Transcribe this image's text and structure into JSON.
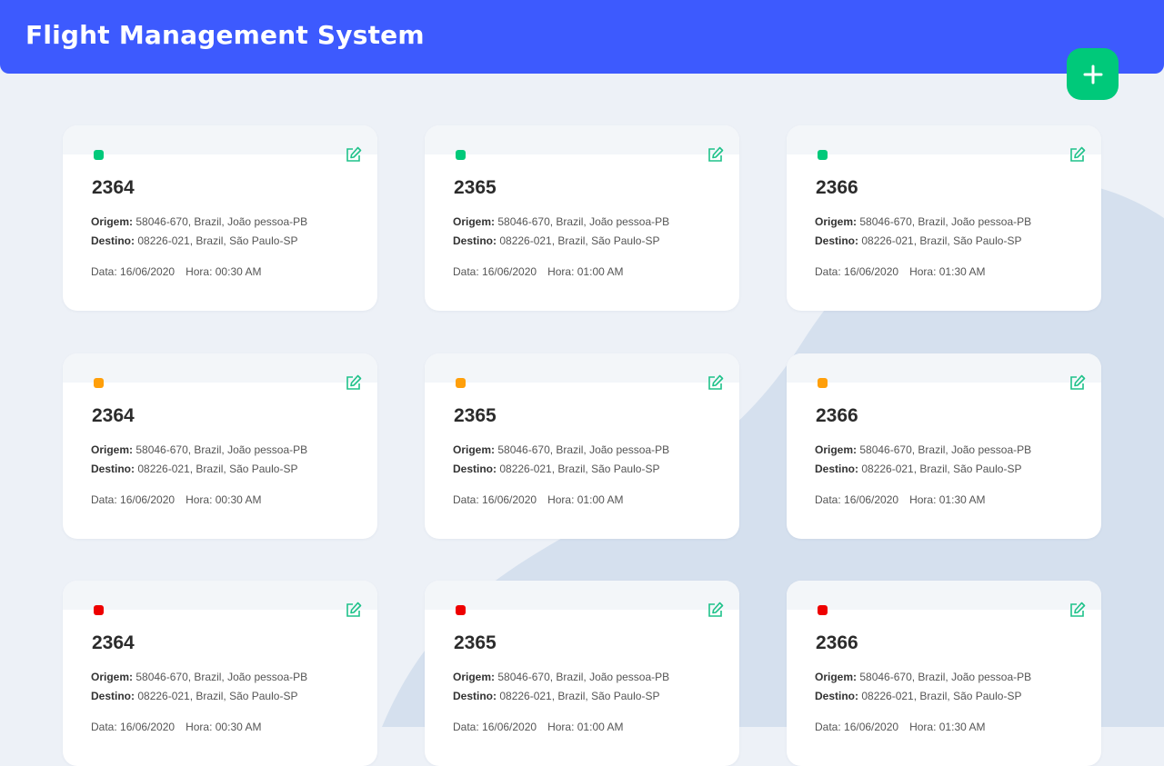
{
  "header": {
    "title": "Flight Management System"
  },
  "add_button": {
    "icon": "plus-icon"
  },
  "labels": {
    "origem": "Origem:",
    "destino": "Destino:"
  },
  "status_colors": {
    "green": "#00c97a",
    "orange": "#ff9f0a",
    "red": "#ee0000"
  },
  "edit_color": "#1fc28a",
  "flights": [
    {
      "status": "green",
      "number": "2364",
      "origem": "58046-670, Brazil, João pessoa-PB",
      "destino": "08226-021, Brazil, São Paulo-SP",
      "data": "Data: 16/06/2020",
      "hora": "Hora: 00:30 AM"
    },
    {
      "status": "green",
      "number": "2365",
      "origem": "58046-670, Brazil, João pessoa-PB",
      "destino": "08226-021, Brazil, São Paulo-SP",
      "data": "Data: 16/06/2020",
      "hora": "Hora: 01:00 AM"
    },
    {
      "status": "green",
      "number": "2366",
      "origem": "58046-670, Brazil, João pessoa-PB",
      "destino": "08226-021, Brazil, São Paulo-SP",
      "data": "Data: 16/06/2020",
      "hora": "Hora: 01:30 AM"
    },
    {
      "status": "orange",
      "number": "2364",
      "origem": "58046-670, Brazil, João pessoa-PB",
      "destino": "08226-021, Brazil, São Paulo-SP",
      "data": "Data: 16/06/2020",
      "hora": "Hora: 00:30 AM"
    },
    {
      "status": "orange",
      "number": "2365",
      "origem": "58046-670, Brazil, João pessoa-PB",
      "destino": "08226-021, Brazil, São Paulo-SP",
      "data": "Data: 16/06/2020",
      "hora": "Hora: 01:00 AM"
    },
    {
      "status": "orange",
      "number": "2366",
      "origem": "58046-670, Brazil, João pessoa-PB",
      "destino": "08226-021, Brazil, São Paulo-SP",
      "data": "Data: 16/06/2020",
      "hora": "Hora: 01:30 AM"
    },
    {
      "status": "red",
      "number": "2364",
      "origem": "58046-670, Brazil, João pessoa-PB",
      "destino": "08226-021, Brazil, São Paulo-SP",
      "data": "Data: 16/06/2020",
      "hora": "Hora: 00:30 AM"
    },
    {
      "status": "red",
      "number": "2365",
      "origem": "58046-670, Brazil, João pessoa-PB",
      "destino": "08226-021, Brazil, São Paulo-SP",
      "data": "Data: 16/06/2020",
      "hora": "Hora: 01:00 AM"
    },
    {
      "status": "red",
      "number": "2366",
      "origem": "58046-670, Brazil, João pessoa-PB",
      "destino": "08226-021, Brazil, São Paulo-SP",
      "data": "Data: 16/06/2020",
      "hora": "Hora: 01:30 AM"
    }
  ]
}
